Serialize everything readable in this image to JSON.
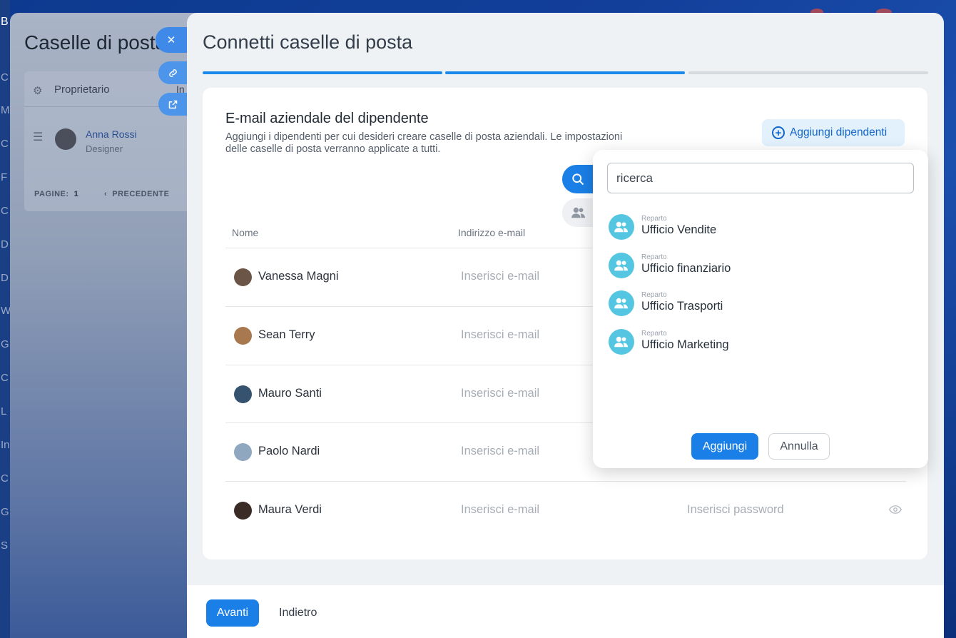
{
  "background": {
    "sidebar_letters": [
      "B",
      "C",
      "M",
      "C",
      "F",
      "C",
      "D",
      "D",
      "W",
      "G",
      "C",
      "L",
      "In",
      "C",
      "G",
      "S"
    ],
    "page_title": "Caselle di posta",
    "table": {
      "owner_label": "Proprietario",
      "col2_fragment": "In",
      "user_name": "Anna Rossi",
      "user_role": "Designer",
      "pages_label": "PAGINE:",
      "pages_value": "1",
      "prev_label": "PRECEDENTE"
    }
  },
  "dialog": {
    "title": "Connetti caselle di posta",
    "steps_completed": 2,
    "steps_total": 3,
    "section": {
      "title": "E-mail aziendale del dipendente",
      "description": "Aggiungi i dipendenti per cui desideri creare caselle di posta aziendali. Le impostazioni delle caselle di posta verranno applicate a tutti.",
      "add_employees_label": "Aggiungi dipendenti"
    },
    "columns": {
      "name": "Nome",
      "email": "Indirizzo e-mail"
    },
    "rows": [
      {
        "name": "Vanessa Magni",
        "email_placeholder": "Inserisci e-mail",
        "avatar_color": "#6b5547"
      },
      {
        "name": "Sean Terry",
        "email_placeholder": "Inserisci e-mail",
        "avatar_color": "#a8794f"
      },
      {
        "name": "Mauro Santi",
        "email_placeholder": "Inserisci e-mail",
        "avatar_color": "#35526f"
      },
      {
        "name": "Paolo Nardi",
        "email_placeholder": "Inserisci e-mail",
        "avatar_color": "#8fa7bf"
      },
      {
        "name": "Maura Verdi",
        "email_placeholder": "Inserisci e-mail",
        "password_placeholder": "Inserisci password",
        "avatar_color": "#3a2b26"
      }
    ],
    "footer": {
      "next_label": "Avanti",
      "back_label": "Indietro"
    }
  },
  "popup": {
    "search_placeholder": "ricerca",
    "departments": [
      {
        "type_label": "Reparto",
        "name": "Ufficio Vendite"
      },
      {
        "type_label": "Reparto",
        "name": "Ufficio finanziario"
      },
      {
        "type_label": "Reparto",
        "name": "Ufficio Trasporti"
      },
      {
        "type_label": "Reparto",
        "name": "Ufficio Marketing"
      }
    ],
    "add_label": "Aggiungi",
    "cancel_label": "Annulla"
  },
  "colors": {
    "accent": "#1a7fe6",
    "department_icon": "#55c6e2",
    "progress_active": "#1a8aeb",
    "progress_inactive": "#d5dadf"
  }
}
